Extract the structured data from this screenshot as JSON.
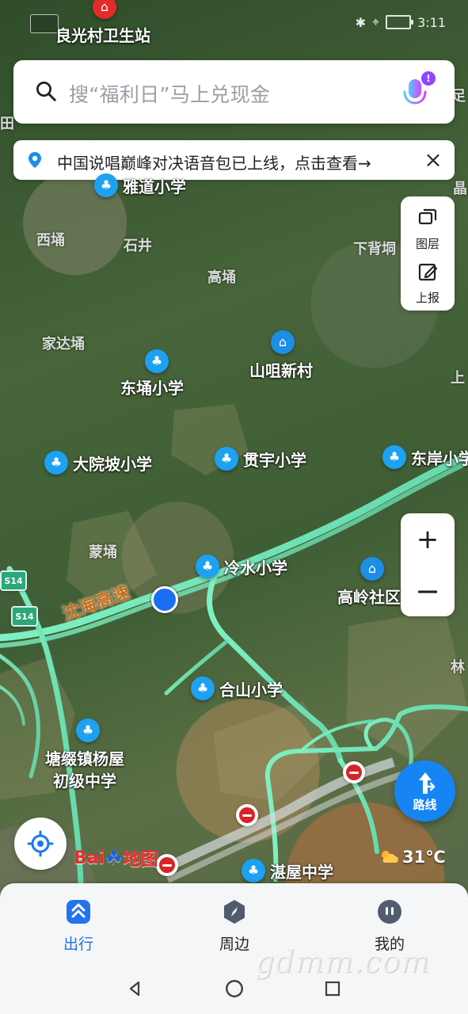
{
  "status_bar": {
    "time": "3:11"
  },
  "search": {
    "placeholder": "搜“福利日”马上兑现金",
    "voice_badge": "!"
  },
  "notice": {
    "text": "中国说唱巅峰对决语音包已上线，点击查看→",
    "close": "×"
  },
  "side_panel": {
    "layers_label": "图层",
    "report_label": "上报"
  },
  "zoom": {
    "in": "+",
    "out": "−"
  },
  "route": {
    "label": "路线"
  },
  "map": {
    "poi": [
      {
        "name": "良光村卫生站"
      },
      {
        "name": "雅道小学"
      },
      {
        "name": "山咀新村"
      },
      {
        "name": "东埇小学"
      },
      {
        "name": "大院坡小学"
      },
      {
        "name": "贯宇小学"
      },
      {
        "name": "东岸小学"
      },
      {
        "name": "冷水小学"
      },
      {
        "name": "高岭社区"
      },
      {
        "name": "合山小学"
      },
      {
        "name": "塘缀镇杨屋"
      },
      {
        "name": "初级中学"
      },
      {
        "name": "湛屋中学"
      }
    ],
    "areas": [
      {
        "name": "西埇"
      },
      {
        "name": "石井"
      },
      {
        "name": "高埇"
      },
      {
        "name": "下背垌"
      },
      {
        "name": "家达埇"
      },
      {
        "name": "蒙埇"
      }
    ],
    "road_name": "沈海高速",
    "highway_signs": [
      "S14",
      "S14"
    ],
    "edge_labels": [
      "田",
      "足",
      "晶",
      "上",
      "林"
    ]
  },
  "brand": {
    "logo_text": "Bai",
    "logo_suffix": "地图"
  },
  "weather": {
    "temp": "31℃"
  },
  "bottom_nav": {
    "items": [
      {
        "label": "出行"
      },
      {
        "label": "周边"
      },
      {
        "label": "我的"
      }
    ]
  },
  "watermark": "gdmm.com",
  "colors": {
    "accent": "#1685f3",
    "active_nav": "#2170ea",
    "road": "#6fe0b1",
    "poi": "#1d9df0"
  }
}
